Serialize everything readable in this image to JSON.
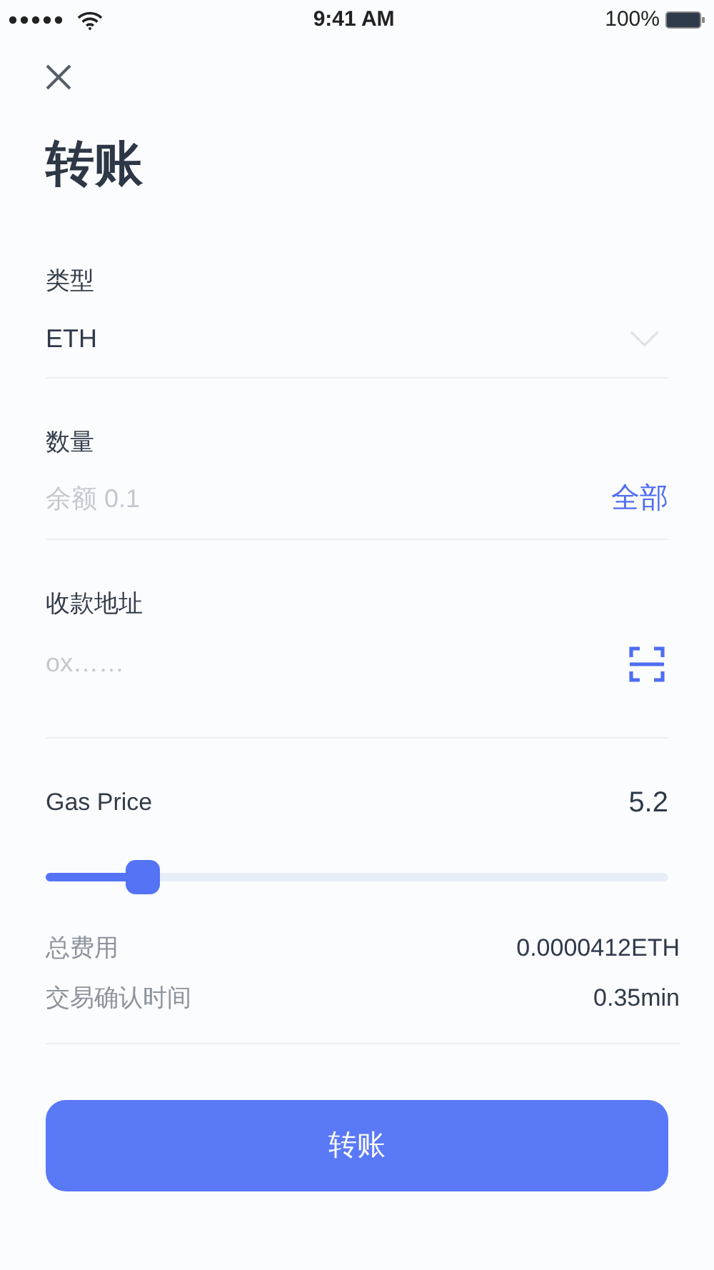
{
  "status_bar": {
    "time": "9:41 AM",
    "battery": "100%"
  },
  "title": "转账",
  "fields": [
    {
      "kind": "select",
      "label": "类型",
      "value": "ETH"
    },
    {
      "kind": "amount",
      "label": "数量",
      "placeholder": "余额 0.1",
      "action": "全部"
    },
    {
      "kind": "address",
      "label": "收款地址",
      "placeholder": "ox……"
    }
  ],
  "gas": {
    "label": "Gas Price",
    "reading": "5.2",
    "level": 0.156
  },
  "summary": [
    {
      "label": "总费用",
      "value": "0.0000412ETH"
    },
    {
      "label": "交易确认时间",
      "value": "0.35min"
    }
  ],
  "submit": "转账"
}
